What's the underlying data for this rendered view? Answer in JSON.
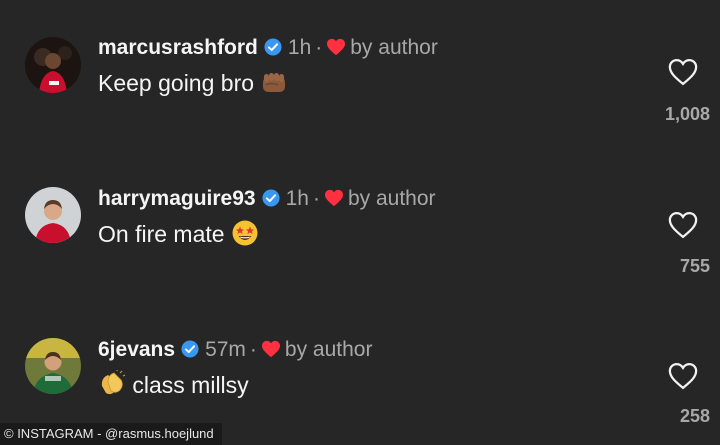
{
  "comments": [
    {
      "username": "marcusrashford",
      "time": "1h",
      "liked_by": "by author",
      "text": "Keep going bro",
      "emoji": "fist-emoji",
      "likes": "1,008"
    },
    {
      "username": "harrymaguire93",
      "time": "1h",
      "liked_by": "by author",
      "text": "On fire mate",
      "emoji": "star-struck-emoji",
      "likes": "755"
    },
    {
      "username": "6jevans",
      "time": "57m",
      "liked_by": "by author",
      "text": "class millsy",
      "emoji": "clapping-hands-emoji",
      "likes": "258"
    }
  ],
  "separator": "·",
  "caption": "© INSTAGRAM - @rasmus.hoejlund",
  "colors": {
    "background": "#262626",
    "verified": "#3897f0",
    "heart": "#ff3040",
    "secondary_text": "#a8a8a8"
  }
}
